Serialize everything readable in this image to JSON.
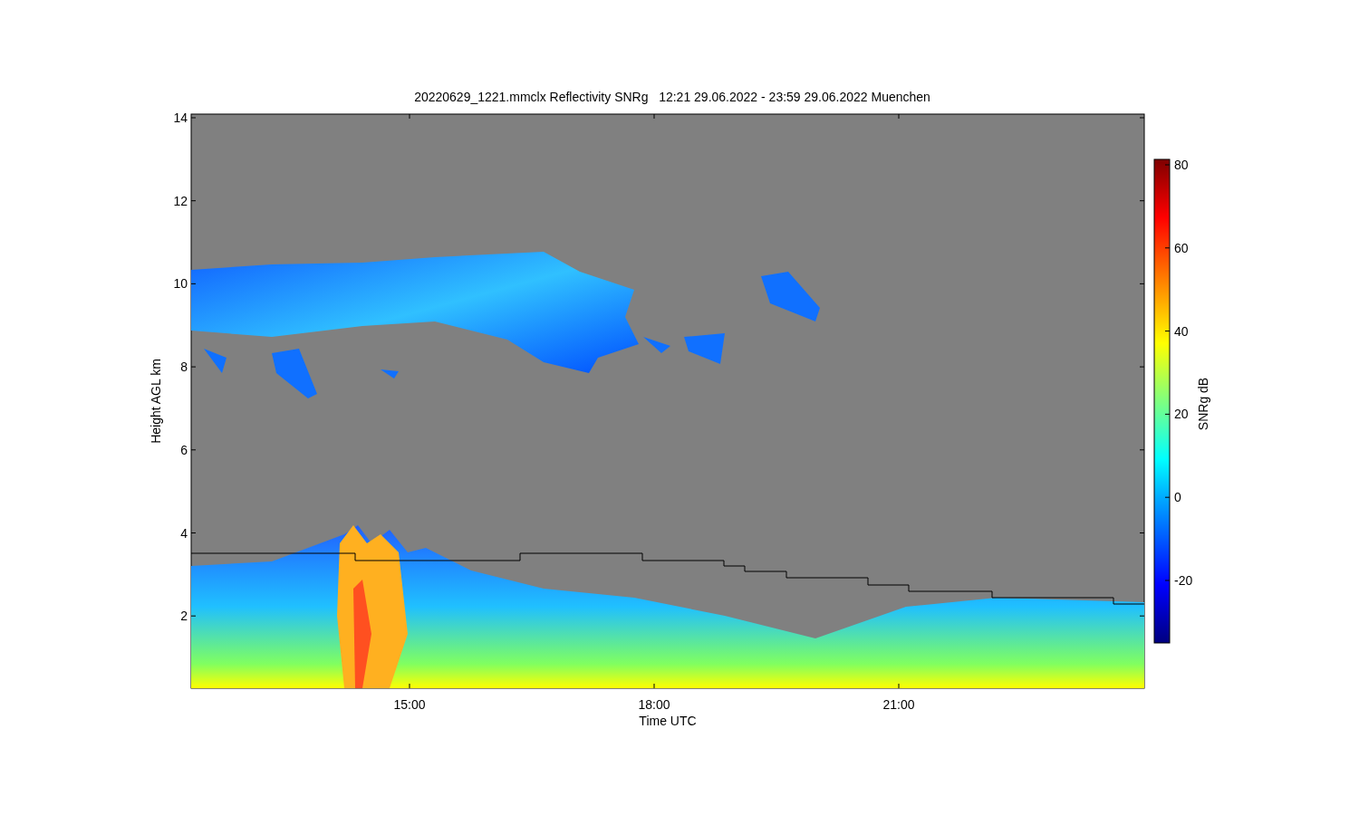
{
  "title": "20220629_1221.mmclx Reflectivity SNRg   12:21 29.06.2022 - 23:59 29.06.2022 Muenchen",
  "y_axis": {
    "label": "Height AGL km",
    "ticks": [
      "14",
      "12",
      "10",
      "8",
      "6",
      "4",
      "2"
    ]
  },
  "x_axis": {
    "label": "Time UTC",
    "ticks": [
      "15:00",
      "18:00",
      "21:00"
    ]
  },
  "colorbar": {
    "label": "SNRg dB",
    "ticks": [
      "80",
      "60",
      "40",
      "20",
      "0",
      "-20"
    ]
  }
}
